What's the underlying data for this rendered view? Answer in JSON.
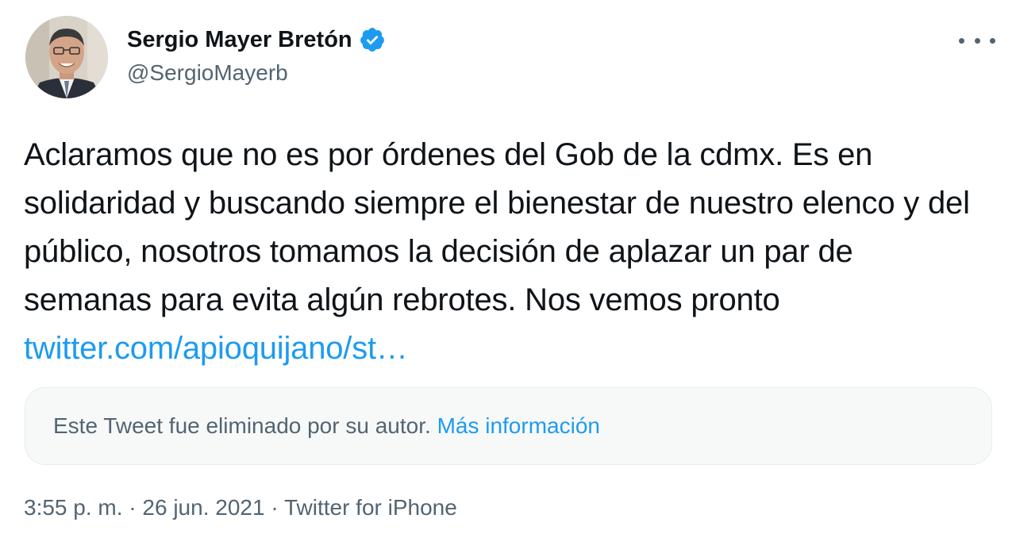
{
  "author": {
    "display_name": "Sergio Mayer Bretón",
    "handle": "@SergioMayerb",
    "verified": true
  },
  "tweet": {
    "text_plain": "Aclaramos que no es por órdenes del Gob de la cdmx. Es en solidaridad y buscando siempre el bienestar de nuestro elenco y del público, nosotros tomamos la decisión de aplazar un par de semanas para evita algún rebrotes. Nos vemos pronto ",
    "link_text": "twitter.com/apioquijano/st…"
  },
  "quoted": {
    "deleted_message": "Este Tweet fue eliminado por su autor.",
    "more_info_label": "Más información"
  },
  "meta": {
    "time": "3:55 p. m.",
    "separator": " · ",
    "date": "26 jun. 2021",
    "source": "Twitter for iPhone"
  },
  "icons": {
    "verified": "verified-badge-icon",
    "more": "more-options-icon"
  },
  "colors": {
    "text": "#0f1419",
    "secondary": "#536471",
    "link": "#1d9bf0",
    "card_bg": "#f7f9f9"
  }
}
